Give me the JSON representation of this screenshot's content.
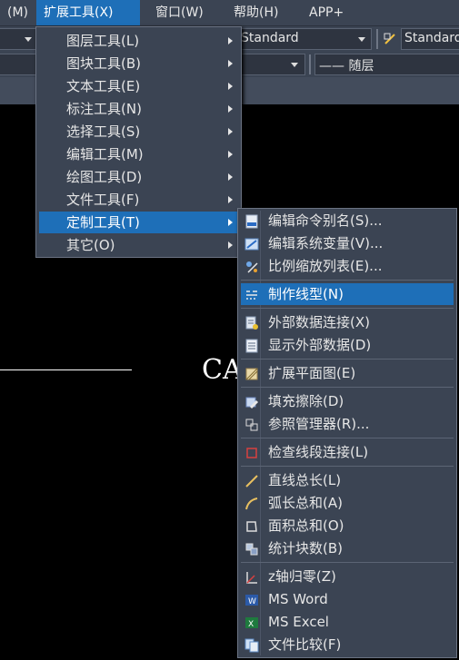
{
  "menubar": {
    "items": [
      "(M)",
      "扩展工具(X)",
      "窗口(W)",
      "帮助(H)",
      "APP+"
    ]
  },
  "toolbar": {
    "text_style": "Standard",
    "dim_style": "Standard",
    "linetype": "—— 随层"
  },
  "canvas": {
    "text": "CA"
  },
  "menu_ext": {
    "items": [
      {
        "label": "图层工具(L)",
        "submenu": true
      },
      {
        "label": "图块工具(B)",
        "submenu": true
      },
      {
        "label": "文本工具(E)",
        "submenu": true
      },
      {
        "label": "标注工具(N)",
        "submenu": true
      },
      {
        "label": "选择工具(S)",
        "submenu": true
      },
      {
        "label": "编辑工具(M)",
        "submenu": true
      },
      {
        "label": "绘图工具(D)",
        "submenu": true
      },
      {
        "label": "文件工具(F)",
        "submenu": true
      },
      {
        "label": "定制工具(T)",
        "submenu": true,
        "highlighted": true
      },
      {
        "label": "其它(O)",
        "submenu": true
      }
    ]
  },
  "menu_custom": {
    "items": [
      {
        "label": "编辑命令别名(S)...",
        "icon": "pgp-file-icon"
      },
      {
        "label": "编辑系统变量(V)...",
        "icon": "system-variable-icon"
      },
      {
        "label": "比例缩放列表(E)...",
        "icon": "scale-list-icon"
      },
      {
        "label": "制作线型(N)",
        "icon": "linetype-icon",
        "highlighted": true
      },
      {
        "label": "外部数据连接(X)",
        "icon": "data-link-icon"
      },
      {
        "label": "显示外部数据(D)",
        "icon": "external-data-icon"
      },
      {
        "label": "扩展平面图(E)",
        "icon": "extend-plan-icon"
      },
      {
        "label": "填充擦除(D)",
        "icon": "hatch-erase-icon"
      },
      {
        "label": "参照管理器(R)...",
        "icon": "reference-manager-icon"
      },
      {
        "label": "检查线段连接(L)",
        "icon": "check-segment-icon"
      },
      {
        "label": "直线总长(L)",
        "icon": "line-length-icon"
      },
      {
        "label": "弧长总和(A)",
        "icon": "arc-length-icon"
      },
      {
        "label": "面积总和(O)",
        "icon": "area-sum-icon"
      },
      {
        "label": "统计块数(B)",
        "icon": "block-count-icon"
      },
      {
        "label": "z轴归零(Z)",
        "icon": "z-axis-zero-icon"
      },
      {
        "label": "MS Word",
        "icon": "word-icon"
      },
      {
        "label": "MS Excel",
        "icon": "excel-icon"
      },
      {
        "label": "文件比较(F)",
        "icon": "file-compare-icon"
      }
    ]
  },
  "colors": {
    "highlight": "#1e6fb8",
    "menu_bg": "#3b4453"
  }
}
